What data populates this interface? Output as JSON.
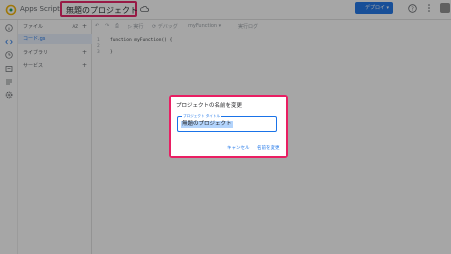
{
  "header": {
    "app_name": "Apps Script",
    "project_title": "無題のプロジェクト",
    "deploy_label": "デプロイ",
    "deploy_caret": "▾"
  },
  "files_panel": {
    "files_header": "ファイル",
    "file_item": "コード.gs",
    "libraries": "ライブラリ",
    "services": "サービス",
    "sort_icon": "AZ",
    "add_icon": "+"
  },
  "toolbar": {
    "items": [
      "↶",
      "↷",
      "⎙",
      "▷ 実行",
      "⟳ デバッグ",
      "myFunction ▾",
      "実行ログ"
    ]
  },
  "editor": {
    "line_numbers": [
      "1",
      "2",
      "3"
    ],
    "lines": [
      "function myFunction() {",
      "  ",
      "}"
    ]
  },
  "dialog": {
    "title": "プロジェクトの名前を変更",
    "field_label": "プロジェクト タイトル",
    "field_value": "無題のプロジェクト",
    "cancel_label": "キャンセル",
    "rename_label": "名前を変更"
  },
  "colors": {
    "accent": "#1a73e8",
    "highlight": "#e91e63",
    "selection": "#b3d4fc"
  }
}
